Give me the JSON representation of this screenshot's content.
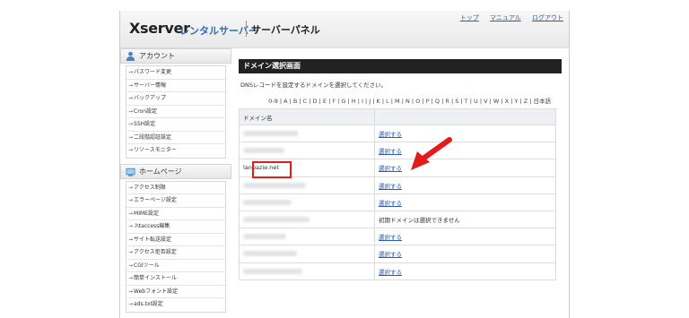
{
  "header": {
    "brand": "Xserver",
    "product": "レンタルサーバー",
    "panel": "サーバーパネル",
    "links": [
      "トップ",
      "マニュアル",
      "ログアウト"
    ]
  },
  "sidebar": {
    "account": {
      "title": "アカウント",
      "items": [
        "パスワード変更",
        "サーバー情報",
        "バックアップ",
        "Cron設定",
        "SSH設定",
        "二段階認証設定",
        "リソースモニター"
      ]
    },
    "homepage": {
      "title": "ホームページ",
      "items": [
        "アクセス制限",
        "エラーページ設定",
        "MIME設定",
        ".htaccess編集",
        "サイト転送設定",
        "アクセス拒否設定",
        "CGIツール",
        "簡単インストール",
        "Webフォント設定",
        "ads.txt設定"
      ]
    }
  },
  "main": {
    "title": "ドメイン選択画面",
    "description": "DNSレコードを設定するドメインを選択してください。",
    "alphabet": [
      "0-9",
      "A",
      "B",
      "C",
      "D",
      "E",
      "F",
      "G",
      "H",
      "I",
      "J",
      "K",
      "L",
      "M",
      "N",
      "O",
      "P",
      "Q",
      "R",
      "S",
      "T",
      "U",
      "V",
      "W",
      "X",
      "Y",
      "Z",
      "日本語"
    ],
    "alphabet_linked": [
      "F",
      "L",
      "P",
      "R",
      "T"
    ],
    "table": {
      "header": "ドメイン名",
      "rows": [
        {
          "domain": "",
          "action": "選択する"
        },
        {
          "domain": "",
          "action": "選択する"
        },
        {
          "domain": "lanpazie.net",
          "action": "選択する"
        },
        {
          "domain": "",
          "action": "選択する"
        },
        {
          "domain": "",
          "action": "選択する"
        },
        {
          "domain": "",
          "action": "初期ドメインは選択できません"
        },
        {
          "domain": "",
          "action": "選択する"
        },
        {
          "domain": "",
          "action": "選択する"
        },
        {
          "domain": "",
          "action": "選択する"
        }
      ]
    }
  },
  "colors": {
    "accent_link": "#2a5bb8",
    "highlight": "#e21b1b",
    "title_bar": "#222222"
  },
  "icons": {
    "account": "user-icon",
    "homepage": "home-icon",
    "annotation": "red-arrow-icon"
  }
}
